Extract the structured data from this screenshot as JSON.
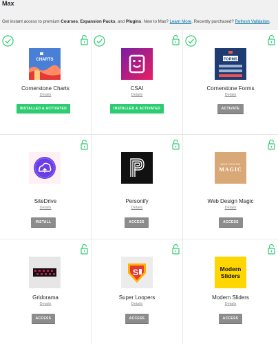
{
  "page": {
    "title": "Max",
    "intro_prefix": "Get instant access to premium ",
    "intro_courses": "Courses",
    "intro_sep1": ", ",
    "intro_expansion": "Expansion Packs",
    "intro_sep2": ", and ",
    "intro_plugins": "Plugins",
    "intro_mid": ". New to Max? ",
    "learn_more": "Learn More",
    "intro_recent": ". Recently purchased? ",
    "refresh_validation": "Refresh Validation",
    "intro_end": "."
  },
  "colors": {
    "accent_green": "#2ecc71",
    "lock_green": "#2ecc71",
    "button_gray": "#8c8c8c",
    "link_blue": "#0073aa"
  },
  "cards": [
    {
      "name": "Cornerstone Charts",
      "details": "Details",
      "button": "INSTALLED & ACTIVATED",
      "installed": true,
      "thumb_label": "CHARTS",
      "icon": "charts-thumbnail"
    },
    {
      "name": "CSAI",
      "details": "Details",
      "button": "INSTALLED & ACTIVATED",
      "installed": true,
      "thumb_label": "",
      "icon": "csai-thumbnail"
    },
    {
      "name": "Cornerstone Forms",
      "details": "Details",
      "button": "ACTIVATE",
      "installed": true,
      "thumb_label": "FORMS",
      "icon": "forms-thumbnail"
    },
    {
      "name": "SiteDrive",
      "details": "Details",
      "button": "INSTALL",
      "installed": false,
      "thumb_label": "",
      "icon": "sitedrive-thumbnail"
    },
    {
      "name": "Personify",
      "details": "Details",
      "button": "ACCESS",
      "installed": false,
      "thumb_label": "",
      "icon": "personify-thumbnail"
    },
    {
      "name": "Web Design Magic",
      "details": "Details",
      "button": "ACCESS",
      "installed": false,
      "thumb_label": "WEB DESIGN",
      "thumb_label2": "MAGIC",
      "icon": "web-design-magic-thumbnail"
    },
    {
      "name": "Gridorama",
      "details": "Details",
      "button": "ACCESS",
      "installed": false,
      "thumb_label": "",
      "icon": "gridorama-thumbnail"
    },
    {
      "name": "Super Loopers",
      "details": "Details",
      "button": "ACCESS",
      "installed": false,
      "thumb_label": "",
      "icon": "super-loopers-thumbnail"
    },
    {
      "name": "Modern Sliders",
      "details": "Details",
      "button": "ACCESS",
      "installed": false,
      "thumb_label": "Modern",
      "thumb_label2": "Sliders",
      "icon": "modern-sliders-thumbnail"
    }
  ]
}
